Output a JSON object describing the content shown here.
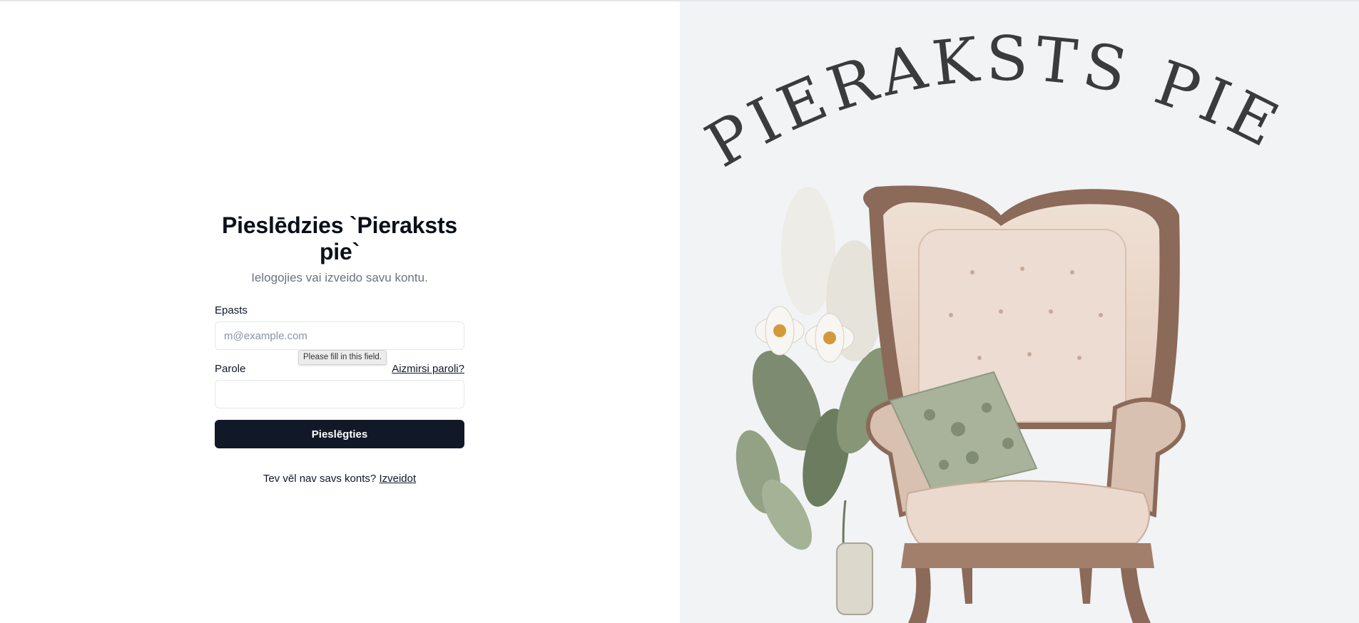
{
  "login": {
    "title": "Pieslēdzies `Pieraksts pie`",
    "subtitle": "Ielogojies vai izveido savu kontu.",
    "email_label": "Epasts",
    "email_placeholder": "m@example.com",
    "email_value": "",
    "validation_tooltip": "Please fill in this field.",
    "password_label": "Parole",
    "password_value": "",
    "forgot_link": "Aizmirsi paroli?",
    "submit_label": "Pieslēgties",
    "signup_prompt": "Tev vēl nav savs konts?",
    "signup_link": "Izveidot"
  },
  "hero": {
    "logo_text": "PIERAKSTS PIE",
    "image_description_icon": "armchair-illustration",
    "background_color": "#f1f3f5"
  },
  "colors": {
    "primary_button": "#111827",
    "muted_text": "#6b7280",
    "input_border": "#e2e8f0"
  }
}
